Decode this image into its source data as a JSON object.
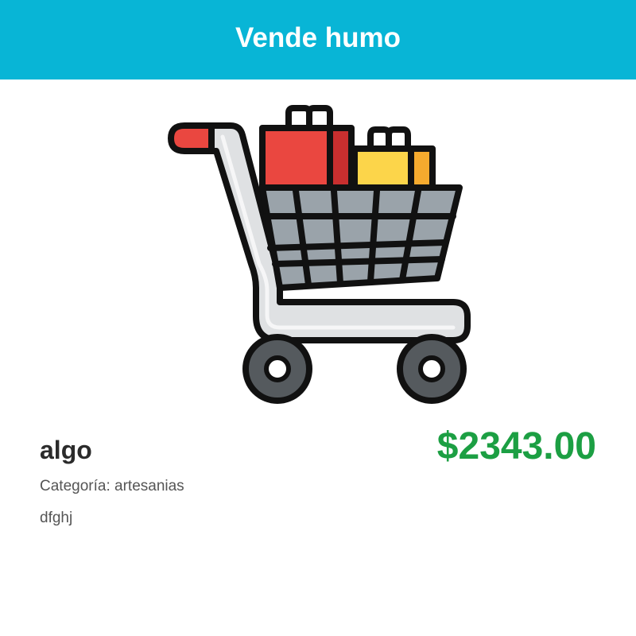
{
  "header": {
    "title": "Vende humo",
    "background_color": "#08b5d6"
  },
  "product": {
    "image_icon": "shopping-cart-icon",
    "name": "algo",
    "price": "$2343.00",
    "price_color": "#1c9f43",
    "category_label": "Categoría:",
    "category": "artesanias",
    "description": "dfghj"
  }
}
